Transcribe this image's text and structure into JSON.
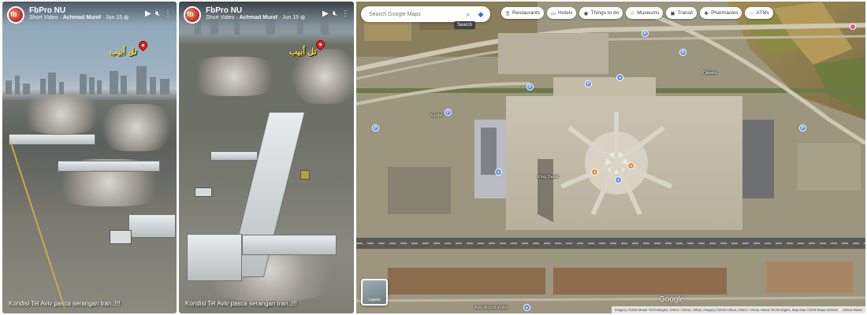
{
  "facebook": {
    "panels": [
      {
        "page_name": "FbPro NU",
        "video_type": "Short Video",
        "author": "Achmad Munif",
        "date": "Jun 15",
        "location_label": "تل أبيب",
        "caption": "Kondisi Tel Aviv pasca serangan Iran..!!!",
        "icons": {
          "logo": "fb-logo",
          "play": "play-icon",
          "mute": "volume-mute-icon",
          "more": "more-icon",
          "globe": "globe-icon",
          "pin": "map-pin-icon"
        }
      },
      {
        "page_name": "FbPro NU",
        "video_type": "Short Video",
        "author": "Achmad Munif",
        "date": "Jun 15",
        "location_label": "تل أبيب",
        "caption": "Kondisi Tel Aviv pasca serangan Iran..!!!",
        "icons": {
          "logo": "fb-logo",
          "play": "play-icon",
          "mute": "volume-mute-icon",
          "more": "more-icon",
          "globe": "globe-icon",
          "pin": "map-pin-icon"
        }
      }
    ]
  },
  "maps": {
    "search": {
      "placeholder": "Search Google Maps",
      "tooltip": "Search",
      "search_icon": "search-icon",
      "directions_icon": "directions-icon"
    },
    "chips": [
      {
        "label": "Restaurants",
        "icon": "fork-knife-icon"
      },
      {
        "label": "Hotels",
        "icon": "bed-icon"
      },
      {
        "label": "Things to do",
        "icon": "camera-icon"
      },
      {
        "label": "Museums",
        "icon": "museum-icon"
      },
      {
        "label": "Transit",
        "icon": "train-icon"
      },
      {
        "label": "Pharmacies",
        "icon": "pharmacy-icon"
      },
      {
        "label": "ATMs",
        "icon": "more-horizontal-icon"
      }
    ],
    "labels": {
      "king_david": "King David",
      "airport_entry": "Aviv Airport Entry",
      "kanfei": "Kanfei",
      "derekh": "Derekh"
    },
    "layers_label": "Layers",
    "google_logo": "Google",
    "attribution": "Imagery ©2025 Maxar Technologies, CNES / Airbus, Airbus, Imagery ©2025 Airbus, CNES / Airbus, Maxar Technologies, Map data ©2025 Mapa GISrael",
    "attribution_extra": "United States",
    "colors": {
      "accent": "#1a73e8",
      "poi_blue": "#5b8ef0",
      "poi_orange": "#e8892b",
      "pin_pink": "#e04fa5"
    }
  }
}
